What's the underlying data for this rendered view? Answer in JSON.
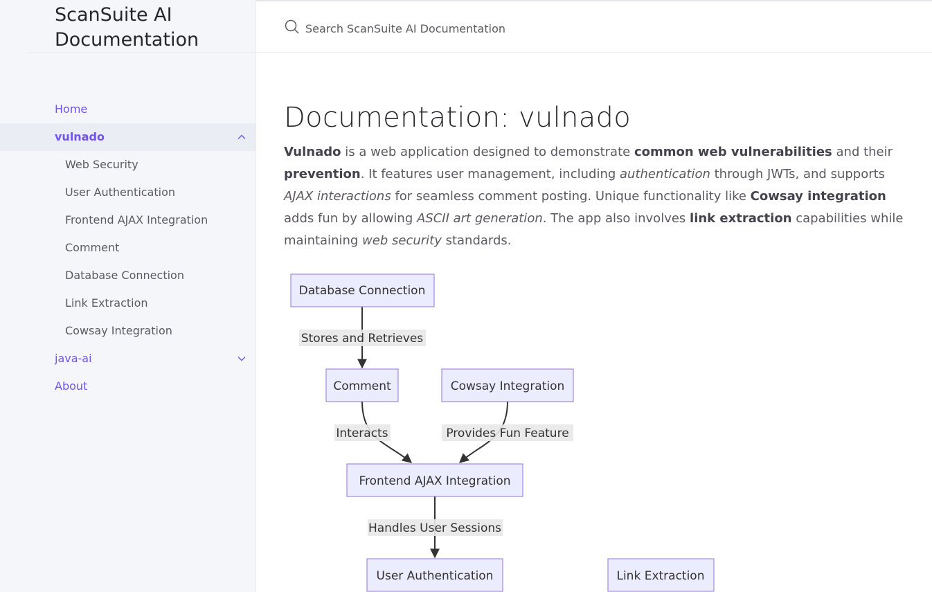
{
  "site": {
    "title": "ScanSuite AI Documentation"
  },
  "search": {
    "placeholder": "Search ScanSuite AI Documentation"
  },
  "sidebar": {
    "items": [
      {
        "label": "Home"
      },
      {
        "label": "vulnado",
        "expanded": true,
        "children": [
          "Web Security",
          "User Authentication",
          "Frontend AJAX Integration",
          "Comment",
          "Database Connection",
          "Link Extraction",
          "Cowsay Integration"
        ]
      },
      {
        "label": "java-ai",
        "expanded": false
      },
      {
        "label": "About"
      }
    ]
  },
  "page": {
    "title": "Documentation: vulnado",
    "intro": [
      {
        "t": "Vulnado",
        "b": true
      },
      {
        "t": " is a web application designed to demonstrate "
      },
      {
        "t": "common web vulnerabilities",
        "b": true
      },
      {
        "t": " and their "
      },
      {
        "t": "prevention",
        "b": true
      },
      {
        "t": ". It features user management, including "
      },
      {
        "t": "authentication",
        "i": true
      },
      {
        "t": " through JWTs, and supports "
      },
      {
        "t": "AJAX interactions",
        "i": true
      },
      {
        "t": " for seamless comment posting. Unique functionality like "
      },
      {
        "t": "Cowsay integration",
        "b": true
      },
      {
        "t": " adds fun by allowing "
      },
      {
        "t": "ASCII art generation",
        "i": true
      },
      {
        "t": ". The app also involves "
      },
      {
        "t": "link extraction",
        "b": true
      },
      {
        "t": " capabilities while maintaining "
      },
      {
        "t": "web security",
        "i": true
      },
      {
        "t": " standards."
      }
    ]
  },
  "diagram": {
    "nodes": {
      "db": "Database Connection",
      "comment": "Comment",
      "cowsay": "Cowsay Integration",
      "ajax": "Frontend AJAX Integration",
      "auth": "User Authentication",
      "link": "Link Extraction"
    },
    "edges": {
      "db_comment": "Stores and Retrieves",
      "comment_ajax": "Interacts",
      "cowsay_ajax": "Provides Fun Feature",
      "ajax_auth": "Handles User Sessions"
    }
  },
  "colors": {
    "accent": "#7253ed",
    "node_fill": "#ececff",
    "node_stroke": "#9370db"
  }
}
